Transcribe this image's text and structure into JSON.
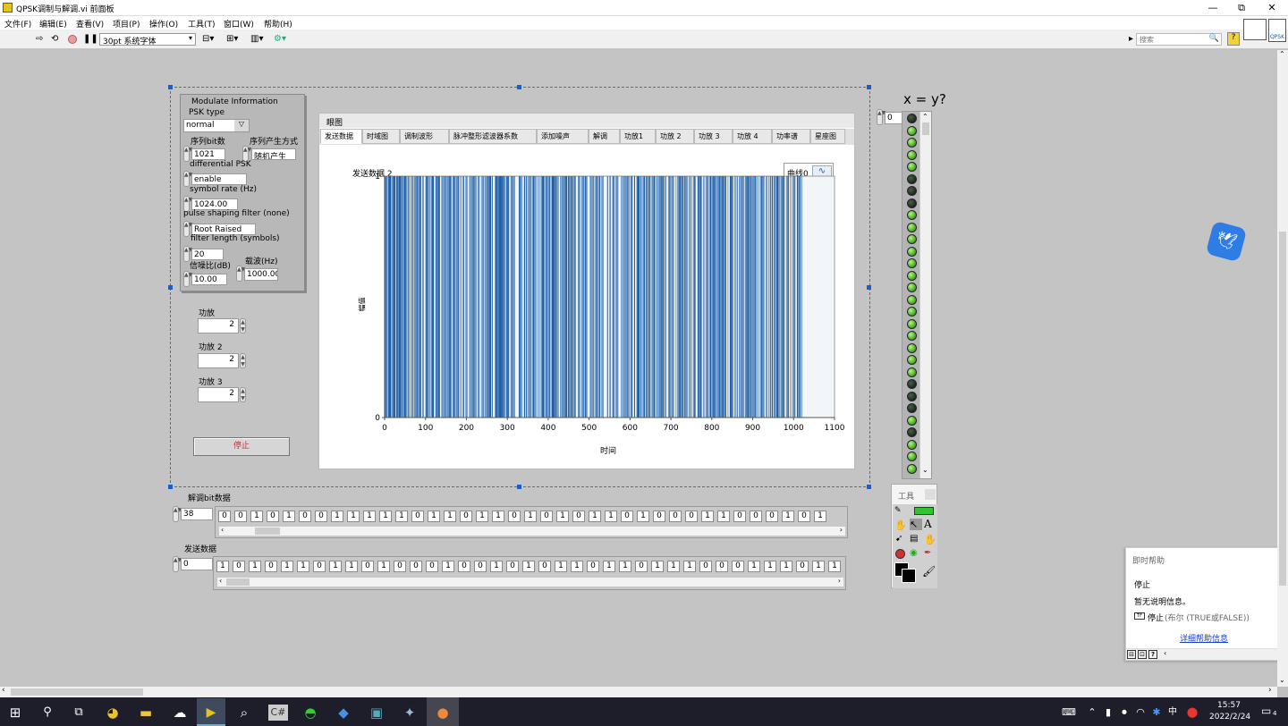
{
  "window": {
    "title": "QPSK调制与解调.vi 前面板",
    "minimize": "—",
    "restore": "⧉",
    "close": "✕"
  },
  "menu": [
    "文件(F)",
    "编辑(E)",
    "查看(V)",
    "项目(P)",
    "操作(O)",
    "工具(T)",
    "窗口(W)",
    "帮助(H)"
  ],
  "toolbar": {
    "font_select": "30pt 系统字体",
    "search_placeholder": "搜索",
    "vi_icon_label": "QPSK"
  },
  "modulate": {
    "title": "Modulate Information",
    "psk_type_label": "PSK type",
    "psk_type_value": "normal",
    "seq_bits_label": "序列bit数",
    "seq_bits_value": "1021",
    "seq_mode_label": "序列产生方式",
    "seq_mode_value": "随机产生",
    "diff_psk_label": "differential PSK",
    "diff_psk_value": "enable",
    "symbol_rate_label": "symbol rate (Hz)",
    "symbol_rate_value": "1024.00",
    "pulse_filter_label": "pulse shaping filter (none)",
    "pulse_filter_value": "Root Raised",
    "filter_len_label": "filter length (symbols)",
    "filter_len_value": "20",
    "snr_label": "信噪比(dB)",
    "snr_value": "10.00",
    "carrier_label": "载波(Hz)",
    "carrier_value": "1000.00"
  },
  "amps": [
    {
      "label": "功放",
      "value": "2"
    },
    {
      "label": "功放 2",
      "value": "2"
    },
    {
      "label": "功放 3",
      "value": "2"
    }
  ],
  "stop_button": "停止",
  "tabs": {
    "group_label": "眼图",
    "items": [
      "发送数据",
      "时域图",
      "调制波形",
      "脉冲整形滤波器系数",
      "添加噪声",
      "解调",
      "功放1",
      "功放 2",
      "功放 3",
      "功放 4",
      "功率谱",
      "星座图"
    ],
    "active_index": 0
  },
  "graph": {
    "title": "发送数据 2",
    "legend_label": "曲线0",
    "ylabel": "幅值",
    "xlabel": "时间"
  },
  "chart_data": {
    "type": "bar",
    "title": "发送数据 2",
    "xlabel": "时间",
    "ylabel": "幅值",
    "x_ticks": [
      "0",
      "100",
      "200",
      "300",
      "400",
      "500",
      "600",
      "700",
      "800",
      "900",
      "1000",
      "1100"
    ],
    "y_ticks": [
      "0",
      "1"
    ],
    "xlim": [
      0,
      1100
    ],
    "ylim": [
      0,
      1
    ],
    "series": [
      {
        "name": "曲线0",
        "n_samples": 1021,
        "values": "random binary 0/1 sequence"
      }
    ],
    "color": "#1f5fa8"
  },
  "led_indicator": {
    "label": "x = y?",
    "index_value": "0",
    "states": [
      0,
      1,
      1,
      1,
      1,
      0,
      0,
      0,
      1,
      1,
      1,
      1,
      1,
      1,
      1,
      1,
      1,
      1,
      1,
      1,
      1,
      1,
      0,
      0,
      0,
      1,
      0,
      1,
      1,
      1,
      1,
      0,
      1,
      0,
      1,
      0,
      1,
      0,
      1,
      0,
      1,
      1,
      1,
      1,
      1,
      0,
      1,
      1,
      0,
      1
    ]
  },
  "demod_array": {
    "label": "解调bit数据",
    "index_value": "38",
    "bits": [
      "0",
      "0",
      "1",
      "0",
      "1",
      "0",
      "0",
      "1",
      "1",
      "1",
      "1",
      "1",
      "0",
      "1",
      "1",
      "0",
      "1",
      "1",
      "0",
      "1",
      "0",
      "1",
      "0",
      "1",
      "1",
      "0",
      "1",
      "0",
      "0",
      "0",
      "1",
      "1",
      "0",
      "0",
      "0",
      "1",
      "0",
      "1"
    ]
  },
  "send_array": {
    "label": "发送数据",
    "index_value": "0",
    "bits": [
      "1",
      "0",
      "1",
      "0",
      "1",
      "1",
      "0",
      "1",
      "1",
      "0",
      "1",
      "0",
      "0",
      "0",
      "1",
      "0",
      "0",
      "1",
      "0",
      "1",
      "0",
      "1",
      "1",
      "0",
      "1",
      "1",
      "0",
      "1",
      "1",
      "1",
      "0",
      "0",
      "0",
      "1",
      "1",
      "1",
      "0",
      "1",
      "1",
      "0",
      "1",
      "0"
    ]
  },
  "tools_palette": {
    "title": "工具"
  },
  "context_help": {
    "title": "即时帮助",
    "name": "停止",
    "desc": "暂无说明信息。",
    "type_line": "停止",
    "type_hint": "(布尔 (TRUE或FALSE))",
    "link": "详细帮助信息"
  },
  "taskbar": {
    "time": "15:57",
    "date": "2022/2/24",
    "ime": "中",
    "notif_count": "4"
  }
}
